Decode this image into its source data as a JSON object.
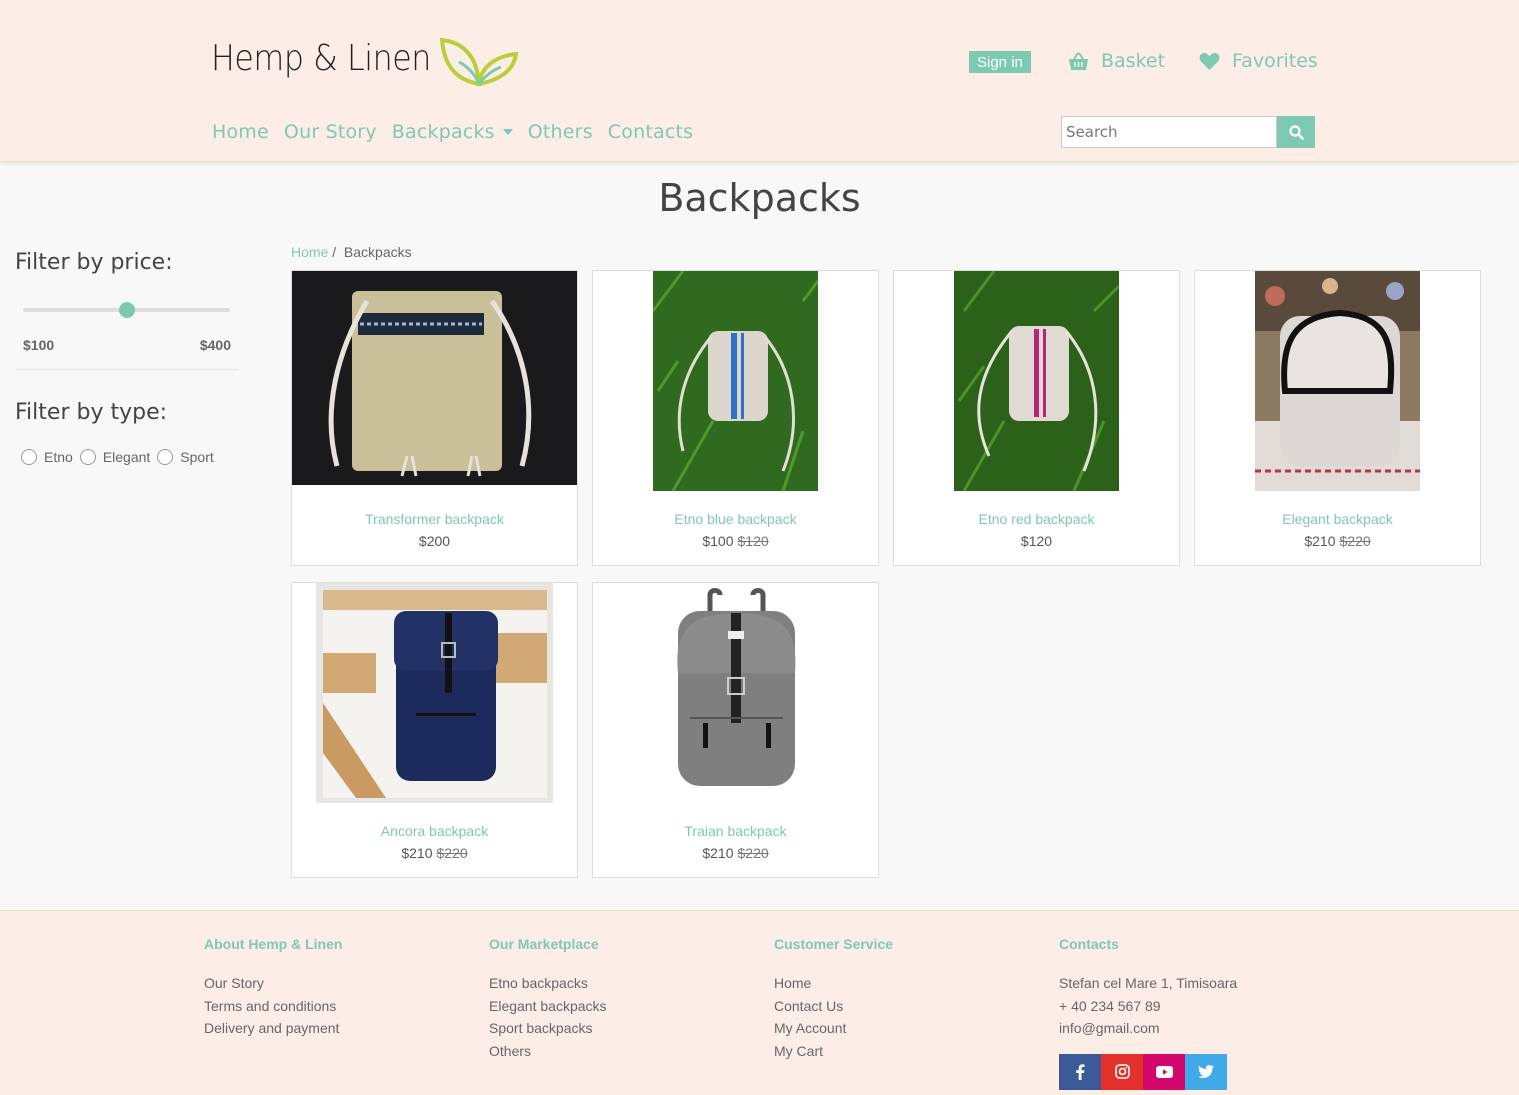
{
  "brand": {
    "name": "Hemp & Linen",
    "accent": "#7dc9b1",
    "background": "#fdede7"
  },
  "header": {
    "sign_in": "Sign in",
    "basket": {
      "label": "Basket",
      "icon": "basket-icon"
    },
    "favorites": {
      "label": "Favorites",
      "icon": "heart-icon"
    },
    "nav": [
      {
        "label": "Home"
      },
      {
        "label": "Our Story"
      },
      {
        "label": "Backpacks",
        "dropdown": true
      },
      {
        "label": "Others"
      },
      {
        "label": "Contacts"
      }
    ],
    "search": {
      "placeholder": "Search",
      "value": "",
      "icon": "search-icon"
    }
  },
  "page": {
    "title": "Backpacks"
  },
  "breadcrumb": {
    "home": "Home",
    "separator": "/",
    "current": "Backpacks"
  },
  "filters": {
    "price": {
      "title": "Filter by price:",
      "min_label": "$100",
      "max_label": "$400",
      "value_fraction": 0.5
    },
    "type": {
      "title": "Filter by type:",
      "options": [
        "Etno",
        "Elegant",
        "Sport"
      ]
    }
  },
  "products": [
    {
      "name": "Transformer backpack",
      "price": "$200",
      "old_price": ""
    },
    {
      "name": "Etno blue backpack",
      "price": "$100",
      "old_price": "$120"
    },
    {
      "name": "Etno red backpack",
      "price": "$120",
      "old_price": ""
    },
    {
      "name": "Elegant backpack",
      "price": "$210",
      "old_price": "$220"
    },
    {
      "name": "Ancora backpack",
      "price": "$210",
      "old_price": "$220"
    },
    {
      "name": "Traian backpack",
      "price": "$210",
      "old_price": "$220"
    }
  ],
  "footer": {
    "about": {
      "title": "About Hemp & Linen",
      "links": [
        "Our Story",
        "Terms and conditions",
        "Delivery and payment"
      ]
    },
    "marketplace": {
      "title": "Our Marketplace",
      "links": [
        "Etno backpacks",
        "Elegant backpacks",
        "Sport backpacks",
        "Others"
      ]
    },
    "service": {
      "title": "Customer Service",
      "links": [
        "Home",
        "Contact Us",
        "My Account",
        "My Cart"
      ]
    },
    "contacts": {
      "title": "Contacts",
      "address": "Stefan cel Mare 1, Timisoara",
      "phone": "+ 40 234 567 89",
      "email": "info@gmail.com",
      "socials": [
        {
          "icon": "facebook-icon",
          "color": "#3b5998"
        },
        {
          "icon": "instagram-icon",
          "color": "#e4312b"
        },
        {
          "icon": "youtube-icon",
          "color": "#d1076c"
        },
        {
          "icon": "twitter-icon",
          "color": "#40a9e8"
        }
      ]
    }
  }
}
